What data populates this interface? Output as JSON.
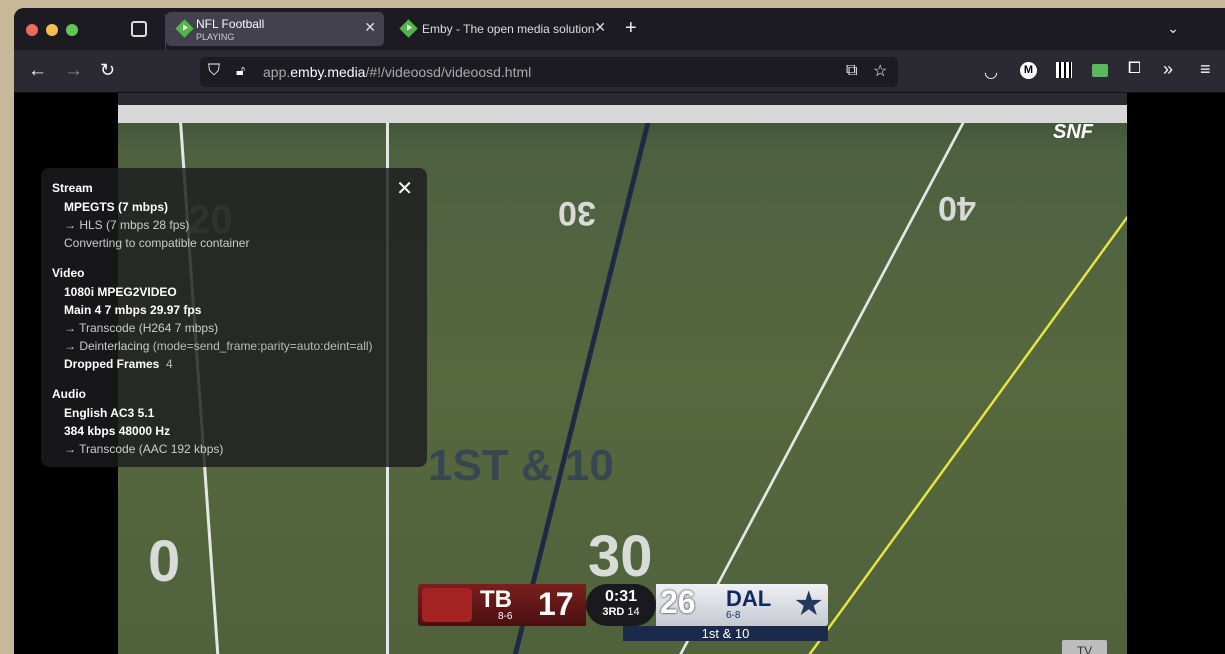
{
  "browser": {
    "tabs": [
      {
        "title": "NFL Football",
        "subtitle": "PLAYING",
        "active": true
      },
      {
        "title": "Emby - The open media solution",
        "active": false
      }
    ],
    "url": {
      "prefix": "app.",
      "domain": "emby.media",
      "path": "/#!/videoosd/videoosd.html"
    },
    "colors": {
      "tabbar": "#1c1b22",
      "navbar": "#2b2a33",
      "emby_green": "#52b54b"
    }
  },
  "video": {
    "network_logo": "SNF",
    "field_numbers": [
      "20",
      "40",
      "30",
      "0",
      "30"
    ],
    "field_graphic": "1ST & 10",
    "scorebug": {
      "away": {
        "abbr": "TB",
        "record": "8-6",
        "score": "17"
      },
      "home": {
        "abbr": "DAL",
        "record": "6-8",
        "score": "26"
      },
      "clock": "0:31",
      "quarter": "3RD",
      "play_clock": "14",
      "down": "1st & 10"
    },
    "tv_label": "TV"
  },
  "stats": {
    "stream": {
      "heading": "Stream",
      "lines": [
        "MPEGTS (7 mbps)",
        "→ HLS (7 mbps 28 fps)",
        "Converting to compatible container"
      ]
    },
    "video": {
      "heading": "Video",
      "lines": [
        "1080i MPEG2VIDEO",
        "Main 4 7 mbps 29.97 fps",
        "→ Transcode (H264 7 mbps)",
        "→ Deinterlacing"
      ],
      "deint_detail": "(mode=send_frame:parity=auto:deint=all)",
      "dropped_label": "Dropped Frames",
      "dropped_value": "4"
    },
    "audio": {
      "heading": "Audio",
      "lines": [
        "English AC3 5.1",
        "384 kbps 48000 Hz",
        "→ Transcode (AAC 192 kbps)"
      ]
    }
  }
}
